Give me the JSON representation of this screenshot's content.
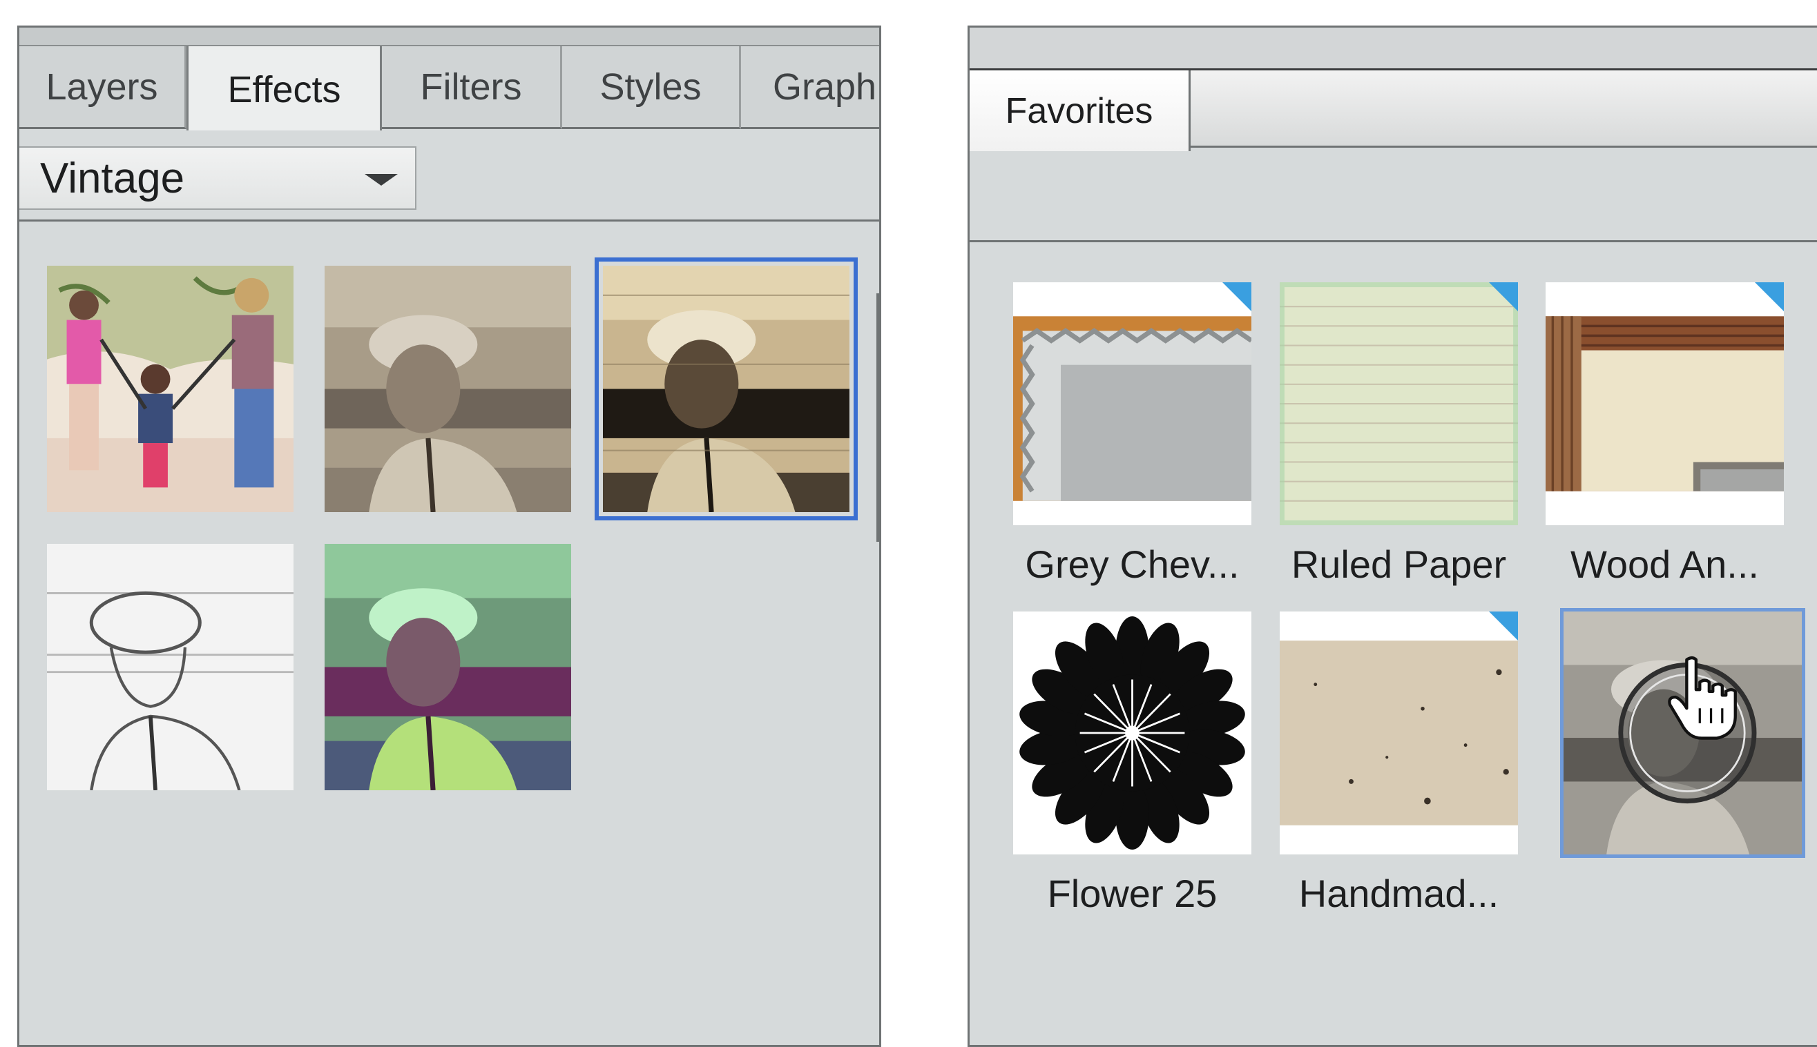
{
  "effects_panel": {
    "tabs": [
      "Layers",
      "Effects",
      "Filters",
      "Styles",
      "Graph"
    ],
    "active_tab": "Effects",
    "category_dropdown": {
      "selected": "Vintage"
    },
    "thumbnails": [
      {
        "name": "Pencil sketch color",
        "selected": false
      },
      {
        "name": "Old photo sepia",
        "selected": false
      },
      {
        "name": "Aged photo",
        "selected": true
      },
      {
        "name": "Pencil sketch",
        "selected": false
      },
      {
        "name": "Cross process",
        "selected": false
      }
    ]
  },
  "favorites_panel": {
    "tab_label": "Favorites",
    "items": [
      {
        "label": "Grey Chev...",
        "has_badge": true
      },
      {
        "label": "Ruled Paper",
        "has_badge": true
      },
      {
        "label": "Wood An...",
        "has_badge": true
      },
      {
        "label": "Flower 25",
        "has_badge": false
      },
      {
        "label": "Handmad...",
        "has_badge": true
      },
      {
        "label": "",
        "has_badge": false,
        "dragging": true
      }
    ]
  },
  "colors": {
    "selection_blue": "#3b6fd1",
    "badge_blue": "#3a9fe0",
    "panel_bg": "#d6dadb"
  },
  "icons": {
    "dropdown": "chevron-down-icon",
    "cursor": "hand-pointer-icon"
  }
}
